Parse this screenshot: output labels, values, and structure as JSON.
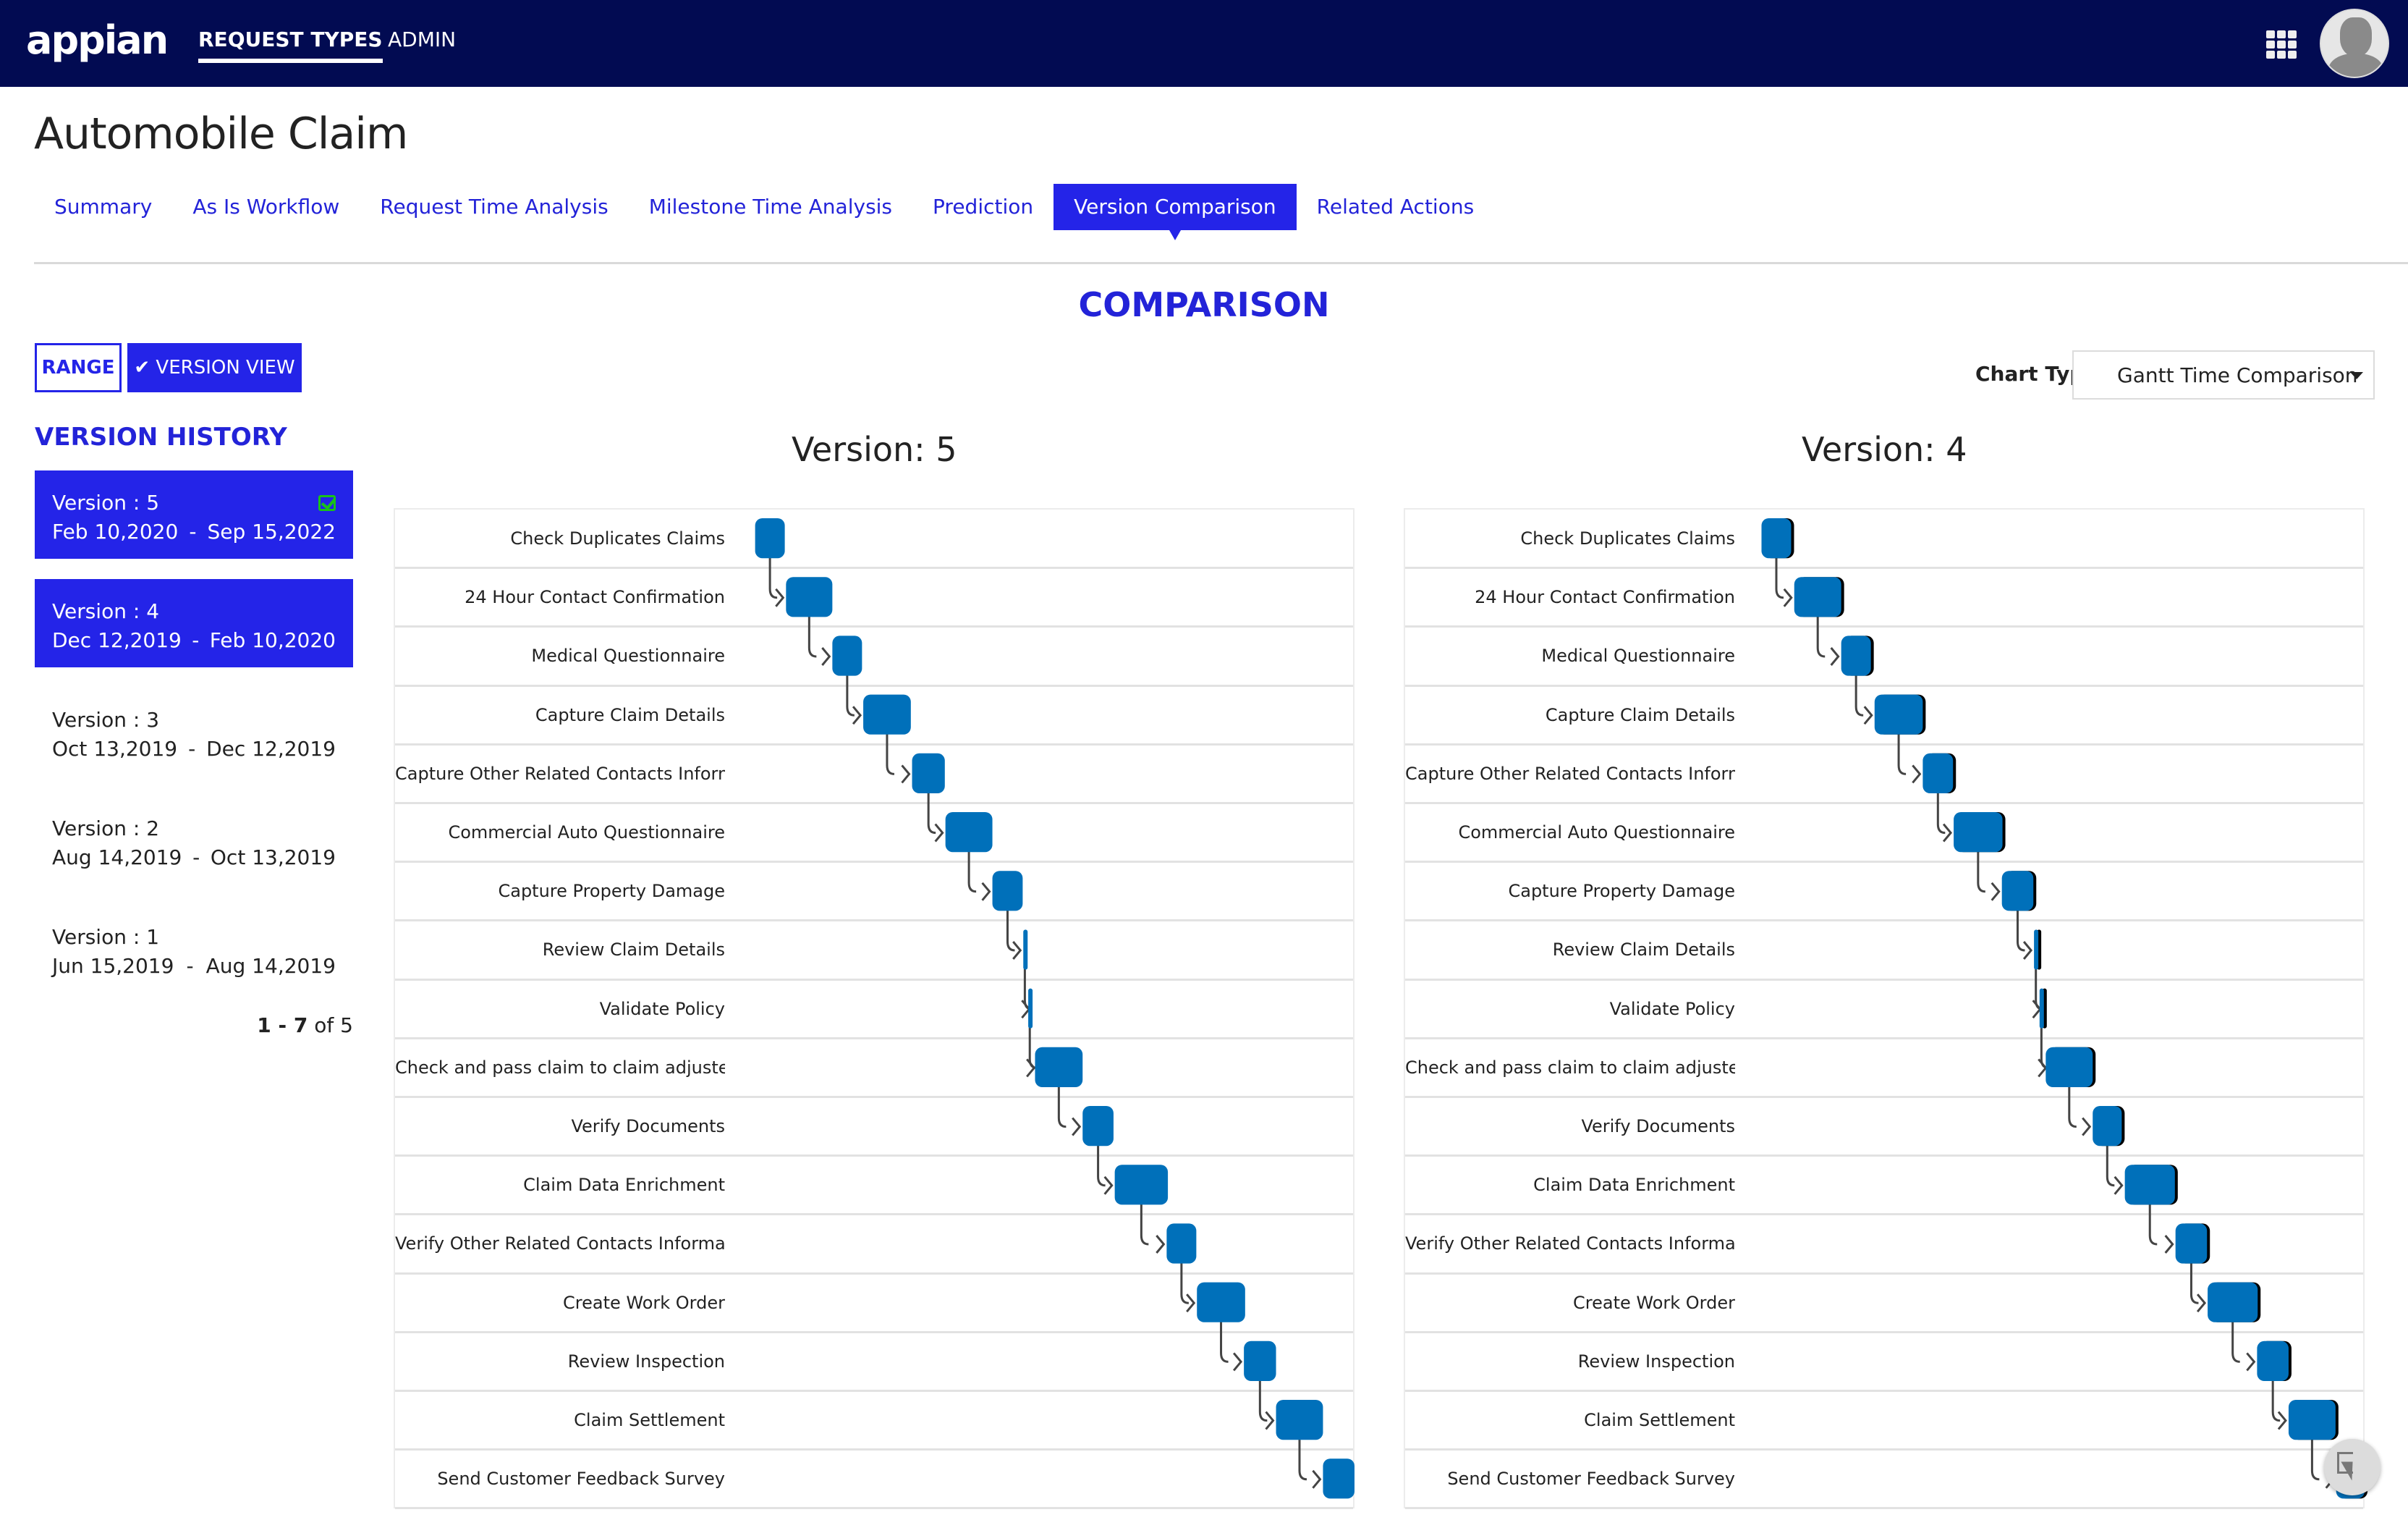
{
  "topbar": {
    "logo": "appian",
    "nav": [
      {
        "label": "REQUEST TYPES",
        "active": true
      },
      {
        "label": "ADMIN",
        "active": false
      }
    ],
    "apps_icon": "grid-icon",
    "avatar_icon": "user-avatar-icon"
  },
  "page": {
    "title": "Automobile Claim",
    "tabs": [
      {
        "label": "Summary",
        "active": false
      },
      {
        "label": "As Is Workflow",
        "active": false
      },
      {
        "label": "Request Time Analysis",
        "active": false
      },
      {
        "label": "Milestone Time Analysis",
        "active": false
      },
      {
        "label": "Prediction",
        "active": false
      },
      {
        "label": "Version Comparison",
        "active": true
      },
      {
        "label": "Related Actions",
        "active": false
      }
    ],
    "section_title": "COMPARISON"
  },
  "view_toggle": {
    "range_label": "RANGE",
    "version_view_label": "✔ VERSION VIEW"
  },
  "chart_type": {
    "label": "Chart Type",
    "selected": "Gantt Time Comparison"
  },
  "version_history": {
    "title": "VERSION HISTORY",
    "items": [
      {
        "version": "Version : 5",
        "start": "Feb 10,2020",
        "sep": "-",
        "end": "Sep 15,2022",
        "selected": true,
        "checked": true
      },
      {
        "version": "Version : 4",
        "start": "Dec 12,2019",
        "sep": "-",
        "end": "Feb 10,2020",
        "selected": true,
        "checked": false
      },
      {
        "version": "Version : 3",
        "start": "Oct 13,2019",
        "sep": "-",
        "end": "Dec 12,2019",
        "selected": false,
        "checked": false
      },
      {
        "version": "Version : 2",
        "start": "Aug 14,2019",
        "sep": "-",
        "end": "Oct 13,2019",
        "selected": false,
        "checked": false
      },
      {
        "version": "Version : 1",
        "start": "Jun 15,2019",
        "sep": "-",
        "end": "Aug 14,2019",
        "selected": false,
        "checked": false
      }
    ],
    "pager": {
      "range": "1 - 7",
      "of_text": "of 5"
    }
  },
  "colors": {
    "brand_navy": "#020b52",
    "accent_blue": "#2424e8",
    "bar_blue": "#0070ba",
    "connector": "#444444",
    "check_green": "#19c219"
  },
  "chart_data": [
    {
      "type": "gantt",
      "title": "Version: 5",
      "x_unit": "relative time (0-100 span of plot area)",
      "xlim": [
        0,
        100
      ],
      "tasks": [
        {
          "name": "Check Duplicates Claims",
          "start": 3.0,
          "end": 7.8
        },
        {
          "name": "24 Hour Contact Confirmation",
          "start": 8.0,
          "end": 15.5
        },
        {
          "name": "Medical Questionnaire",
          "start": 15.5,
          "end": 20.3
        },
        {
          "name": "Capture Claim Details",
          "start": 20.5,
          "end": 28.2
        },
        {
          "name": "Capture Other Related Contacts Information",
          "start": 28.4,
          "end": 33.7
        },
        {
          "name": "Commercial Auto Questionnaire",
          "start": 33.8,
          "end": 41.4
        },
        {
          "name": "Capture Property Damage",
          "start": 41.4,
          "end": 46.3
        },
        {
          "name": "Review Claim Details",
          "start": 46.4,
          "end": 46.9
        },
        {
          "name": "Validate Policy",
          "start": 47.2,
          "end": 47.7
        },
        {
          "name": "Check and pass claim to claim adjuster",
          "start": 48.3,
          "end": 56.0
        },
        {
          "name": "Verify Documents",
          "start": 56.0,
          "end": 61.0
        },
        {
          "name": "Claim Data Enrichment",
          "start": 61.2,
          "end": 69.8
        },
        {
          "name": "Verify Other Related Contacts Information",
          "start": 69.6,
          "end": 74.4
        },
        {
          "name": "Create Work Order",
          "start": 74.5,
          "end": 82.3
        },
        {
          "name": "Review Inspection",
          "start": 82.1,
          "end": 87.3
        },
        {
          "name": "Claim Settlement",
          "start": 87.3,
          "end": 94.9
        },
        {
          "name": "Send Customer Feedback Survey",
          "start": 94.9,
          "end": 100.0
        }
      ]
    },
    {
      "type": "gantt",
      "title": "Version: 4",
      "x_unit": "relative time (0-100 span of plot area)",
      "xlim": [
        0,
        100
      ],
      "tasks": [
        {
          "name": "Check Duplicates Claims",
          "start": 2.4,
          "end": 7.2
        },
        {
          "name": "24 Hour Contact Confirmation",
          "start": 7.7,
          "end": 15.3
        },
        {
          "name": "Medical Questionnaire",
          "start": 15.3,
          "end": 20.1
        },
        {
          "name": "Capture Claim Details",
          "start": 20.7,
          "end": 28.5
        },
        {
          "name": "Capture Other Related Contacts Information",
          "start": 28.5,
          "end": 33.4
        },
        {
          "name": "Commercial Auto Questionnaire",
          "start": 33.5,
          "end": 41.4
        },
        {
          "name": "Capture Property Damage",
          "start": 41.3,
          "end": 46.4
        },
        {
          "name": "Review Claim Details",
          "start": 46.5,
          "end": 47.1
        },
        {
          "name": "Validate Policy",
          "start": 47.4,
          "end": 48.0
        },
        {
          "name": "Check and pass claim to claim adjuster",
          "start": 48.4,
          "end": 56.0
        },
        {
          "name": "Verify Documents",
          "start": 56.0,
          "end": 60.7
        },
        {
          "name": "Claim Data Enrichment",
          "start": 61.2,
          "end": 69.3
        },
        {
          "name": "Verify Other Related Contacts Information",
          "start": 69.4,
          "end": 74.5
        },
        {
          "name": "Create Work Order",
          "start": 74.6,
          "end": 82.7
        },
        {
          "name": "Review Inspection",
          "start": 82.6,
          "end": 87.7
        },
        {
          "name": "Claim Settlement",
          "start": 87.7,
          "end": 95.3
        },
        {
          "name": "Send Customer Feedback Survey",
          "start": 95.4,
          "end": 100.0
        }
      ]
    }
  ]
}
